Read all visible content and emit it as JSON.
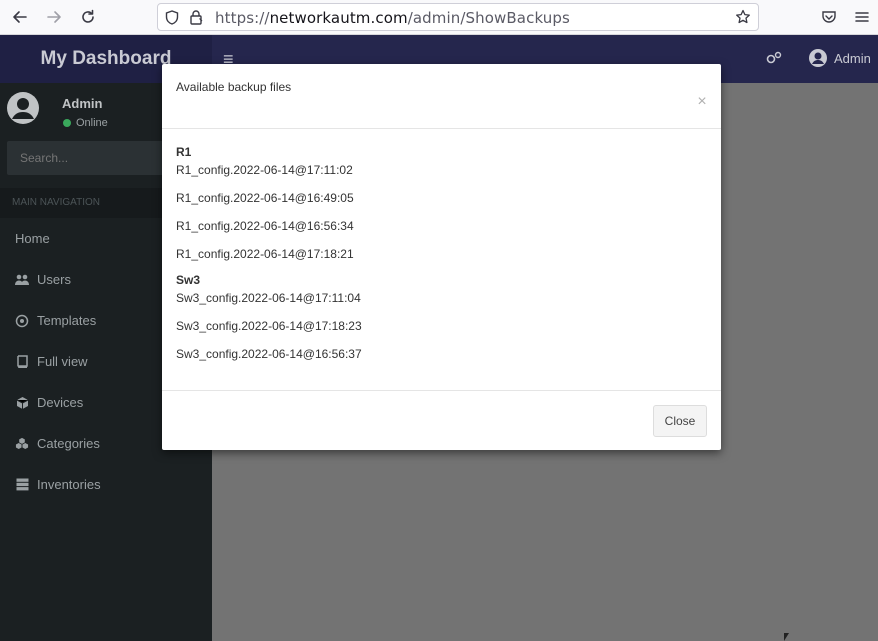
{
  "browser": {
    "url_scheme": "https://",
    "url_host": "networkautm.com",
    "url_path": "/admin/ShowBackups",
    "icons": [
      "back-icon",
      "forward-icon",
      "reload-icon",
      "shield-icon",
      "lock-icon",
      "star-icon",
      "pocket-icon",
      "menu-icon"
    ]
  },
  "app": {
    "brand": "My Dashboard",
    "top_user": "Admin",
    "sidebar": {
      "user_name": "Admin",
      "user_status": "Online",
      "search_placeholder": "Search...",
      "nav_header": "MAIN NAVIGATION",
      "items": [
        {
          "label": "Home",
          "icon": "home-icon"
        },
        {
          "label": "Users",
          "icon": "users-icon"
        },
        {
          "label": "Templates",
          "icon": "templates-icon"
        },
        {
          "label": "Full view",
          "icon": "book-icon"
        },
        {
          "label": "Devices",
          "icon": "cube-icon"
        },
        {
          "label": "Categories",
          "icon": "cubes-icon"
        },
        {
          "label": "Inventories",
          "icon": "server-icon"
        }
      ]
    }
  },
  "modal": {
    "title": "Available backup files",
    "close_x": "×",
    "groups": [
      {
        "name": "R1",
        "files": [
          "R1_config.2022-06-14@17:11:02",
          "R1_config.2022-06-14@16:49:05",
          "R1_config.2022-06-14@16:56:34",
          "R1_config.2022-06-14@17:18:21"
        ]
      },
      {
        "name": "Sw3",
        "files": [
          "Sw3_config.2022-06-14@17:11:04",
          "Sw3_config.2022-06-14@17:18:23",
          "Sw3_config.2022-06-14@16:56:37"
        ]
      }
    ],
    "close_button": "Close"
  },
  "colors": {
    "topbar": "#25264d",
    "sidebar": "#1b2022",
    "content_overlay": "#737373",
    "online_status": "#3aa85c"
  }
}
